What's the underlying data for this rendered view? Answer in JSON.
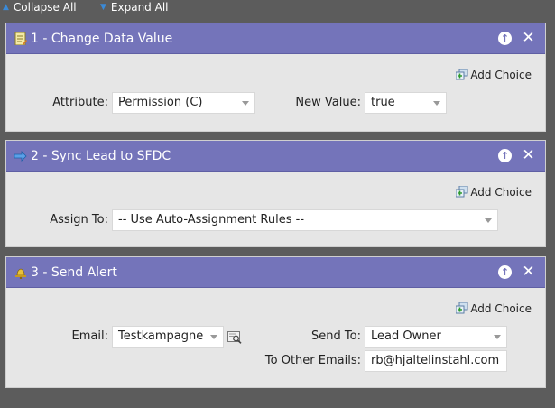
{
  "toolbar": {
    "collapse_all": "Collapse All",
    "expand_all": "Expand All"
  },
  "colors": {
    "header_bg": "#7474ba",
    "panel_bg": "#e6e6e6",
    "page_bg": "#5c5c5c"
  },
  "steps": [
    {
      "title": "1 - Change Data Value",
      "icon": "change-data-icon",
      "add_choice": "Add Choice",
      "fields": {
        "attribute_label": "Attribute:",
        "attribute_value": "Permission (C)",
        "new_value_label": "New Value:",
        "new_value_value": "true"
      }
    },
    {
      "title": "2 - Sync Lead to SFDC",
      "icon": "sync-arrow-icon",
      "add_choice": "Add Choice",
      "fields": {
        "assign_to_label": "Assign To:",
        "assign_to_value": "-- Use Auto-Assignment Rules --"
      }
    },
    {
      "title": "3 - Send Alert",
      "icon": "alert-icon",
      "add_choice": "Add Choice",
      "fields": {
        "email_label": "Email:",
        "email_value": "Testkampagne",
        "send_to_label": "Send To:",
        "send_to_value": "Lead Owner",
        "other_emails_label": "To Other Emails:",
        "other_emails_value": "rb@hjaltelinstahl.com"
      }
    }
  ]
}
